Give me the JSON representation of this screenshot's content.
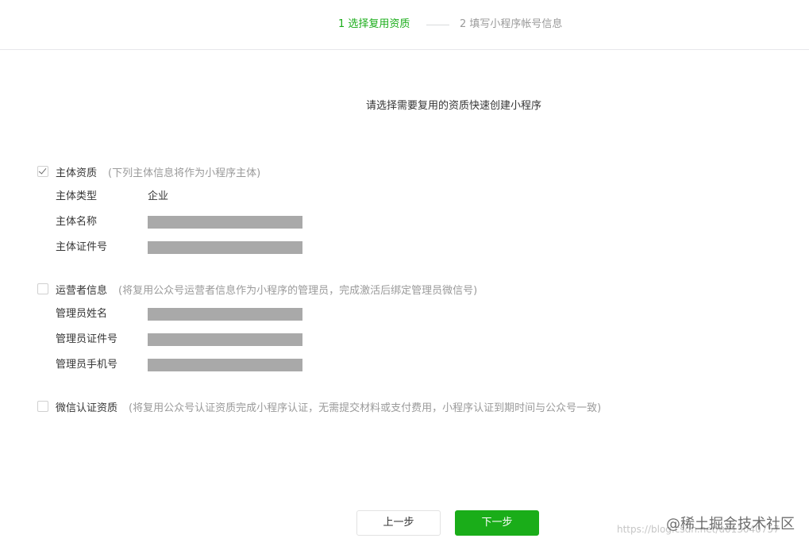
{
  "steps": {
    "step1": "1 选择复用资质",
    "step2": "2 填写小程序帐号信息"
  },
  "subtitle": "请选择需要复用的资质快速创建小程序",
  "subject": {
    "checked": true,
    "title": "主体资质",
    "note": "(下列主体信息将作为小程序主体)",
    "rows": [
      {
        "label": "主体类型",
        "value": "企业"
      },
      {
        "label": "主体名称",
        "value": ""
      },
      {
        "label": "主体证件号",
        "value": ""
      }
    ]
  },
  "operator": {
    "checked": false,
    "title": "运营者信息",
    "note": "(将复用公众号运营者信息作为小程序的管理员，完成激活后绑定管理员微信号)",
    "rows": [
      {
        "label": "管理员姓名",
        "value": ""
      },
      {
        "label": "管理员证件号",
        "value": ""
      },
      {
        "label": "管理员手机号",
        "value": ""
      }
    ]
  },
  "wechat_cert": {
    "checked": false,
    "title": "微信认证资质",
    "note": "(将复用公众号认证资质完成小程序认证，无需提交材料或支付费用，小程序认证到期时间与公众号一致)"
  },
  "buttons": {
    "prev": "上一步",
    "next": "下一步"
  },
  "watermark": {
    "brand": "@稀土掘金技术社区",
    "url": "https://blog.csdn.net/u013040757"
  },
  "colors": {
    "accent": "#1aad19",
    "muted": "#9a9a9a",
    "redacted": "#a9a9a9"
  }
}
